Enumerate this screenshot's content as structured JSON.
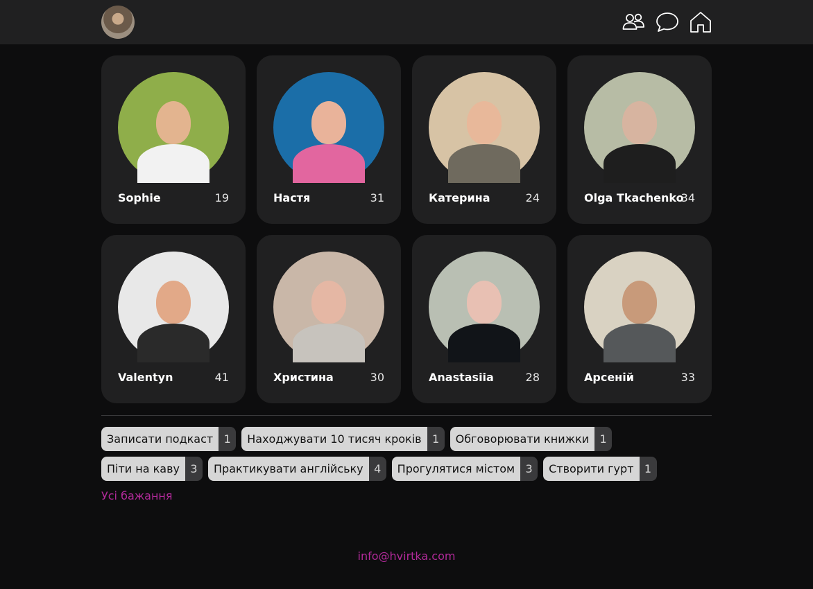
{
  "header": {
    "icons": {
      "avatar": "user-avatar",
      "friends": "people-icon",
      "messages": "chat-bubble-icon",
      "home": "home-icon"
    }
  },
  "profiles": [
    {
      "name": "Sophie",
      "age": "19",
      "palette": [
        "#8fae4a",
        "#e3b48f",
        "#f2f2f2"
      ]
    },
    {
      "name": "Настя",
      "age": "31",
      "palette": [
        "#1b6ea8",
        "#e9b39a",
        "#e2669f"
      ]
    },
    {
      "name": "Катерина",
      "age": "24",
      "palette": [
        "#d7c3a5",
        "#e8b89a",
        "#6f6a5e"
      ]
    },
    {
      "name": "Olga Tkachenko",
      "age": "34",
      "palette": [
        "#b7bca5",
        "#d7b4a0",
        "#1e1e1e"
      ]
    },
    {
      "name": "Valentyn",
      "age": "41",
      "palette": [
        "#e8e8e8",
        "#e2a988",
        "#2a2a2a"
      ]
    },
    {
      "name": "Христина",
      "age": "30",
      "palette": [
        "#c9b7a8",
        "#e5b7a4",
        "#c7c3bd"
      ]
    },
    {
      "name": "Anastasiia",
      "age": "28",
      "palette": [
        "#b9bfb3",
        "#e8c0b3",
        "#111418"
      ]
    },
    {
      "name": "Арсеній",
      "age": "33",
      "palette": [
        "#d9d2c2",
        "#c89a7a",
        "#55585a"
      ]
    }
  ],
  "wishes": [
    {
      "label": "Записати подкаст",
      "count": "1"
    },
    {
      "label": "Находжувати 10 тисяч кроків",
      "count": "1"
    },
    {
      "label": "Обговорювати книжки",
      "count": "1"
    },
    {
      "label": "Піти на каву",
      "count": "3"
    },
    {
      "label": "Практикувати англійську",
      "count": "4"
    },
    {
      "label": "Прогулятися містом",
      "count": "3"
    },
    {
      "label": "Створити гурт",
      "count": "1"
    }
  ],
  "all_wishes_link": "Усі бажання",
  "footer": {
    "email": "info@hvirtka.com"
  },
  "colors": {
    "accent": "#b22a9a",
    "card": "#202021",
    "background": "#0d0d0e"
  }
}
